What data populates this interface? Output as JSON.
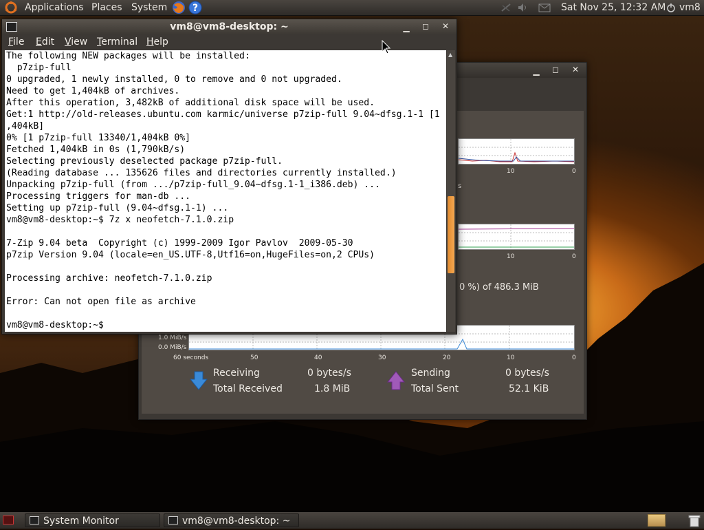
{
  "top_panel": {
    "menus": [
      "Applications",
      "Places",
      "System"
    ],
    "datetime": "Sat Nov 25, 12:32 AM",
    "user": "vm8"
  },
  "terminal": {
    "title": "vm8@vm8-desktop: ~",
    "menu": [
      {
        "first": "F",
        "rest": "ile"
      },
      {
        "first": "E",
        "rest": "dit"
      },
      {
        "first": "V",
        "rest": "iew"
      },
      {
        "first": "T",
        "rest": "erminal"
      },
      {
        "first": "H",
        "rest": "elp"
      }
    ],
    "output": "The following NEW packages will be installed:\n  p7zip-full\n0 upgraded, 1 newly installed, 0 to remove and 0 not upgraded.\nNeed to get 1,404kB of archives.\nAfter this operation, 3,482kB of additional disk space will be used.\nGet:1 http://old-releases.ubuntu.com karmic/universe p7zip-full 9.04~dfsg.1-1 [1\n,404kB]\n0% [1 p7zip-full 13340/1,404kB 0%]\nFetched 1,404kB in 0s (1,790kB/s)\nSelecting previously deselected package p7zip-full.\n(Reading database ... 135626 files and directories currently installed.)\nUnpacking p7zip-full (from .../p7zip-full_9.04~dfsg.1-1_i386.deb) ...\nProcessing triggers for man-db ...\nSetting up p7zip-full (9.04~dfsg.1-1) ...\nvm8@vm8-desktop:~$ 7z x neofetch-7.1.0.zip\n\n7-Zip 9.04 beta  Copyright (c) 1999-2009 Igor Pavlov  2009-05-30\np7zip Version 9.04 (locale=en_US.UTF-8,Utf16=on,HugeFiles=on,2 CPUs)\n\nProcessing archive: neofetch-7.1.0.zip\n\nError: Can not open file as archive\n\nvm8@vm8-desktop:~$ ",
    "scroll_fraction": 0.7
  },
  "system_monitor": {
    "memory_text": "0 %) of 486.3 MiB",
    "cpu_axis": [
      "10",
      "0"
    ],
    "mem_axis": [
      "10",
      "0"
    ],
    "net_axis": [
      "60 seconds",
      "50",
      "40",
      "30",
      "20",
      "10",
      "0"
    ],
    "net_y_labels": [
      "1.0 MiB/s",
      "0.0 MiB/s"
    ],
    "receiving_label": "Receiving",
    "receiving_value": "0 bytes/s",
    "total_received_label": "Total Received",
    "total_received_value": "1.8 MiB",
    "sending_label": "Sending",
    "sending_value": "0 bytes/s",
    "total_sent_label": "Total Sent",
    "total_sent_value": "52.1 KiB",
    "partial_char": "s"
  },
  "taskbar": {
    "items": [
      "System Monitor",
      "vm8@vm8-desktop: ~"
    ]
  },
  "colors": {
    "receive_arrow": "#3a8ad8",
    "send_arrow": "#a05ab8",
    "scroll_thumb": "#e88e30"
  }
}
